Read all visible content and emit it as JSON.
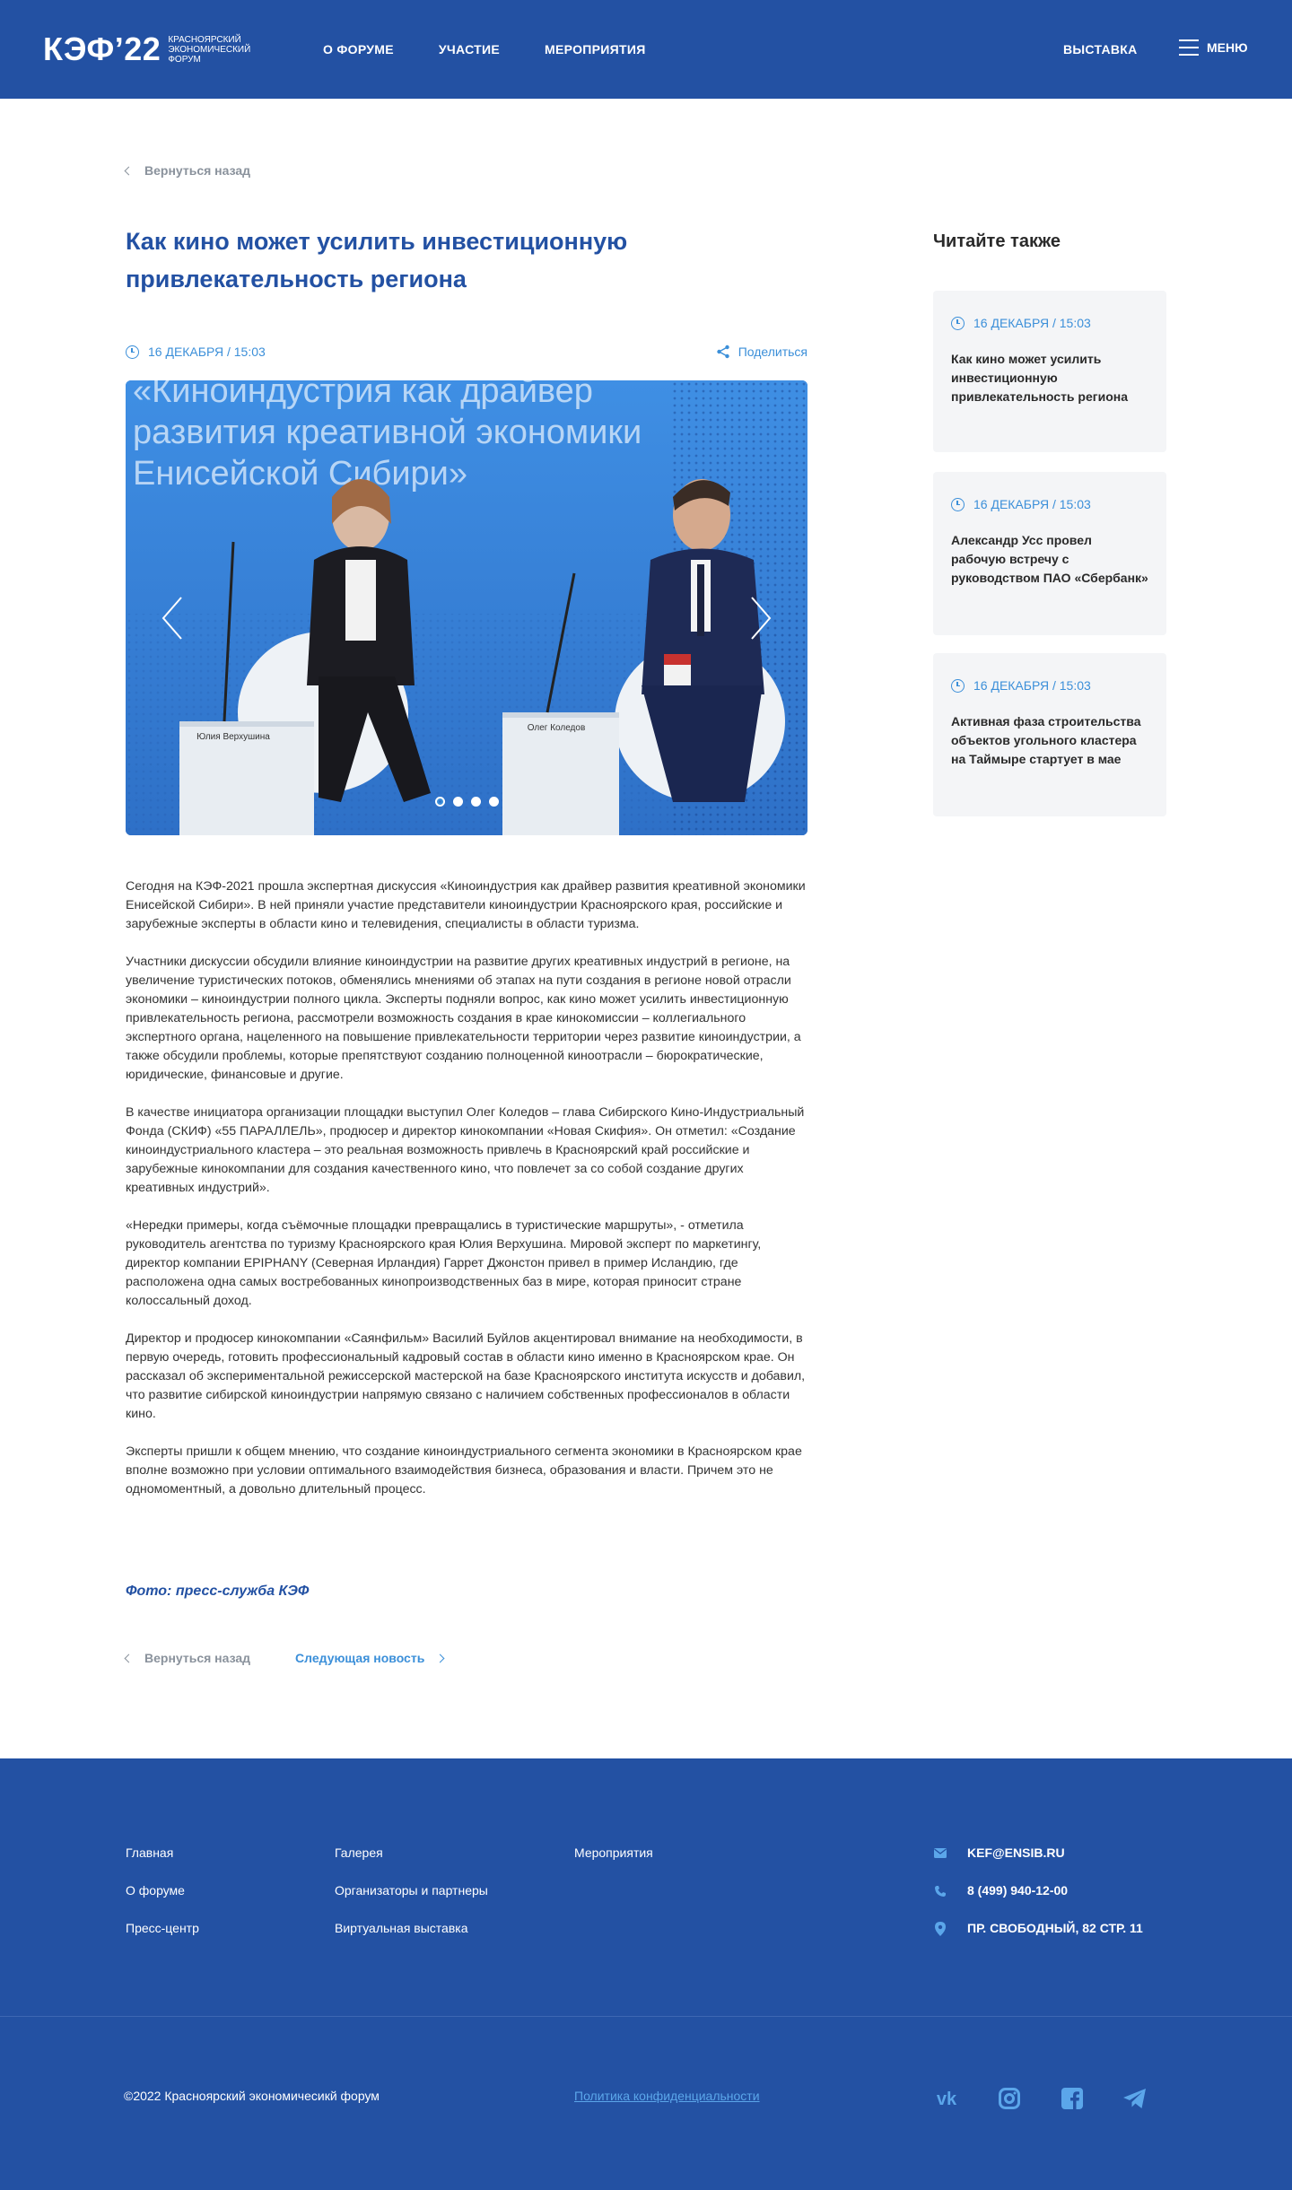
{
  "header": {
    "logo_main": "КЭФ’22",
    "logo_sub": "Красноярский экономический форум",
    "nav_left": [
      "О форуме",
      "Участие",
      "Мероприятия"
    ],
    "nav_right": "Выставка",
    "menu_label": "Меню"
  },
  "colors": {
    "brand": "#2351a3",
    "accent": "#3b8fd9",
    "muted": "#8a929c",
    "card_bg": "#f4f5f7"
  },
  "back_label": "Вернуться назад",
  "article": {
    "title": "Как кино может усилить инвестиционную привлекательность региона",
    "date": "16 ДЕКАБРЯ / 15:03",
    "share_label": "Поделиться",
    "photo_slide_text": "«Киноиндустрия как драйвер развития креативной экономики Енисейской Сибири»",
    "nameplate_left": "Юлия Верхушина",
    "nameplate_right": "Олег Коледов",
    "slides_count": 4,
    "active_slide": 1,
    "paragraphs": [
      "Сегодня на КЭФ-2021 прошла экспертная дискуссия «Киноиндустрия как драйвер развития креативной экономики Енисейской Сибири». В ней приняли участие представители киноиндустрии Красноярского края, российские  и зарубежные эксперты в области кино и телевидения, специалисты в области туризма.",
      "Участники дискуссии обсудили влияние киноиндустрии на развитие других креативных индустрий в регионе, на увеличение туристических потоков, обменялись мнениями об этапах на пути создания в регионе новой отрасли экономики – киноиндустрии полного цикла.  Эксперты подняли вопрос, как кино может усилить инвестиционную привлекательность региона, рассмотрели возможность создания в крае кинокомиссии – коллегиального экспертного органа, нацеленного на повышение привлекательности территории через развитие киноиндустрии, а также обсудили проблемы, которые препятствуют созданию полноценной кинoотрасли – бюрократические, юридические, финансовые и другие.",
      "В качестве инициатора организации площадки выступил Олег Коледов – глава Сибирского Кино-Индустриальный Фонда (СКИФ) «55 ПАРАЛЛЕЛЬ», продюсер и директор кинокомпании «Новая Скифия». Он отметил: «Создание киноиндустриального кластера – это реальная возможность привлечь в Красноярский край российские и зарубежные кинокомпании для создания качественного кино, что повлечет за со собой создание других креативных индустрий».",
      "«Нередки примеры, когда съёмочные площадки превращались в туристические маршруты», - отметила руководитель агентства по туризму Красноярского края Юлия Верхушина. Мировой эксперт по маркетингу, директор компании EPIPHANY (Северная Ирландия) Гаррет Джонстон привел в пример Исландию, где расположена одна самых востребованных  кинопроизводственных баз в мире, которая приносит стране колоссальный доход.",
      "Директор и продюсер кинокомпании «Саянфильм» Василий Буйлов акцентировал внимание на необходимости, в первую очередь, готовить профессиональный кадровый состав в области кино именно в Красноярском крае. Он рассказал об экспериментальной режиссерской мастерской на базе Красноярского института искусств и добавил, что развитие сибирской киноиндустрии напрямую связано с наличием собственных профессионалов в области кино.",
      "Эксперты пришли к общем мнению, что создание киноиндустриального сегмента экономики в Красноярском крае вполне возможно при условии оптимального взаимодействия бизнеса, образования и власти. Причем это не одномоментный, а довольно длительный процесс."
    ],
    "photo_caption": "Фото: пресс-служба КЭФ",
    "next_label": "Следующая новость"
  },
  "sidebar": {
    "title": "Читайте также",
    "cards": [
      {
        "date": "16 ДЕКАБРЯ / 15:03",
        "title": "Как кино может усилить инвестиционную привлекательность региона"
      },
      {
        "date": "16 ДЕКАБРЯ / 15:03",
        "title": "Александр Усс провел рабочую встречу с руководством ПАО «Сбербанк»"
      },
      {
        "date": "16 ДЕКАБРЯ / 15:03",
        "title": "Активная фаза строительства объектов угольного кластера на Таймыре стартует в мае"
      }
    ]
  },
  "footer": {
    "col1": [
      "Главная",
      "О форуме",
      "Пресс-центр"
    ],
    "col2": [
      "Галерея",
      "Организаторы и партнеры",
      "Виртуальная выставка"
    ],
    "col3": [
      "Мероприятия"
    ],
    "email": "KEF@ENSIB.RU",
    "phone": "8 (499) 940-12-00",
    "address": "ПР. СВОБОДНЫЙ, 82 СТР. 11",
    "copyright": "©2022 Красноярский экономичесикй форум",
    "privacy": "Политика конфиденциальности",
    "socials": [
      "vk-icon",
      "instagram-icon",
      "facebook-icon",
      "telegram-icon"
    ]
  }
}
